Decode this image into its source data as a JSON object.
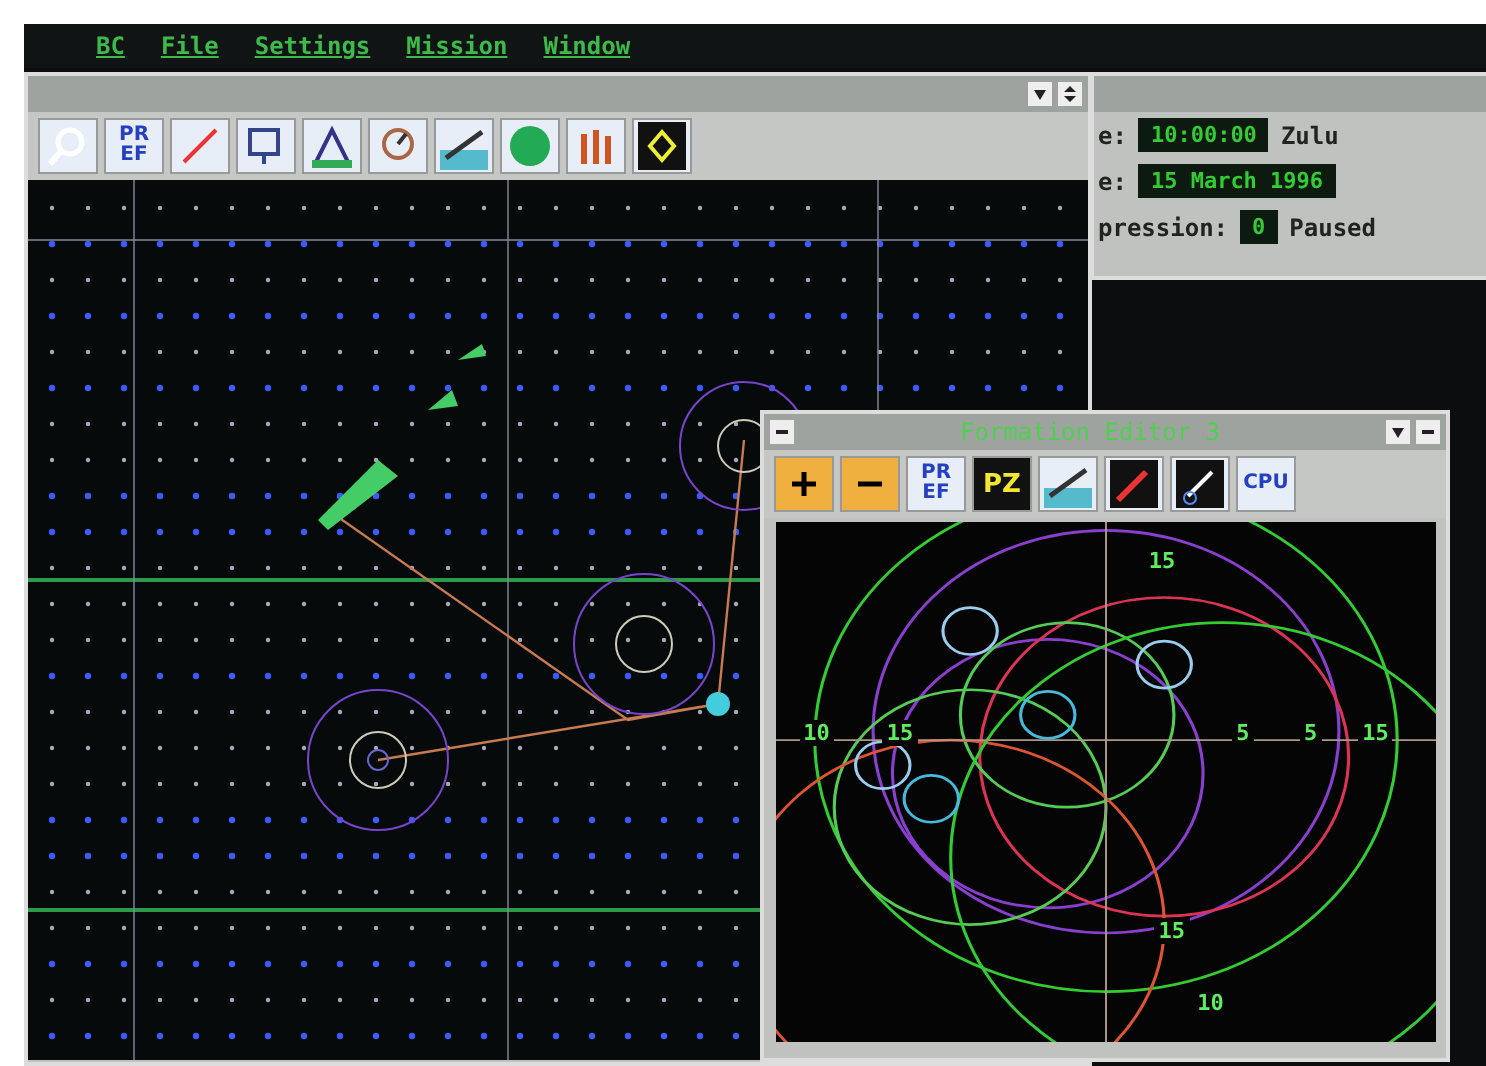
{
  "menu": [
    {
      "label": "BC"
    },
    {
      "label": "File"
    },
    {
      "label": "Settings"
    },
    {
      "label": "Mission"
    },
    {
      "label": "Window"
    }
  ],
  "map_window": {
    "toolbar": [
      {
        "kind": "magnifier"
      },
      {
        "kind": "text",
        "label": "PR EF"
      },
      {
        "kind": "spark"
      },
      {
        "kind": "radar"
      },
      {
        "kind": "plot"
      },
      {
        "kind": "weather"
      },
      {
        "kind": "aircraft"
      },
      {
        "kind": "globe"
      },
      {
        "kind": "bars"
      },
      {
        "kind": "rotate"
      }
    ]
  },
  "status_window": {
    "rows": [
      {
        "label": "e:",
        "value": "10:00:00",
        "unit": "Zulu"
      },
      {
        "label": "e:",
        "value": "15 March 1996"
      },
      {
        "label": "pression:",
        "value": "0",
        "unit": "Paused"
      }
    ]
  },
  "formation_window": {
    "title": "Formation Editor 3",
    "toolbar": [
      {
        "kind": "plus"
      },
      {
        "kind": "minus"
      },
      {
        "kind": "text",
        "label": "PR EF"
      },
      {
        "kind": "text",
        "label": "PZ"
      },
      {
        "kind": "aircraft"
      },
      {
        "kind": "spark"
      },
      {
        "kind": "satellite"
      },
      {
        "kind": "text",
        "label": "CPU"
      }
    ],
    "range_labels": [
      "15",
      "10",
      "15",
      "5",
      "5",
      "15",
      "15",
      "10"
    ]
  }
}
